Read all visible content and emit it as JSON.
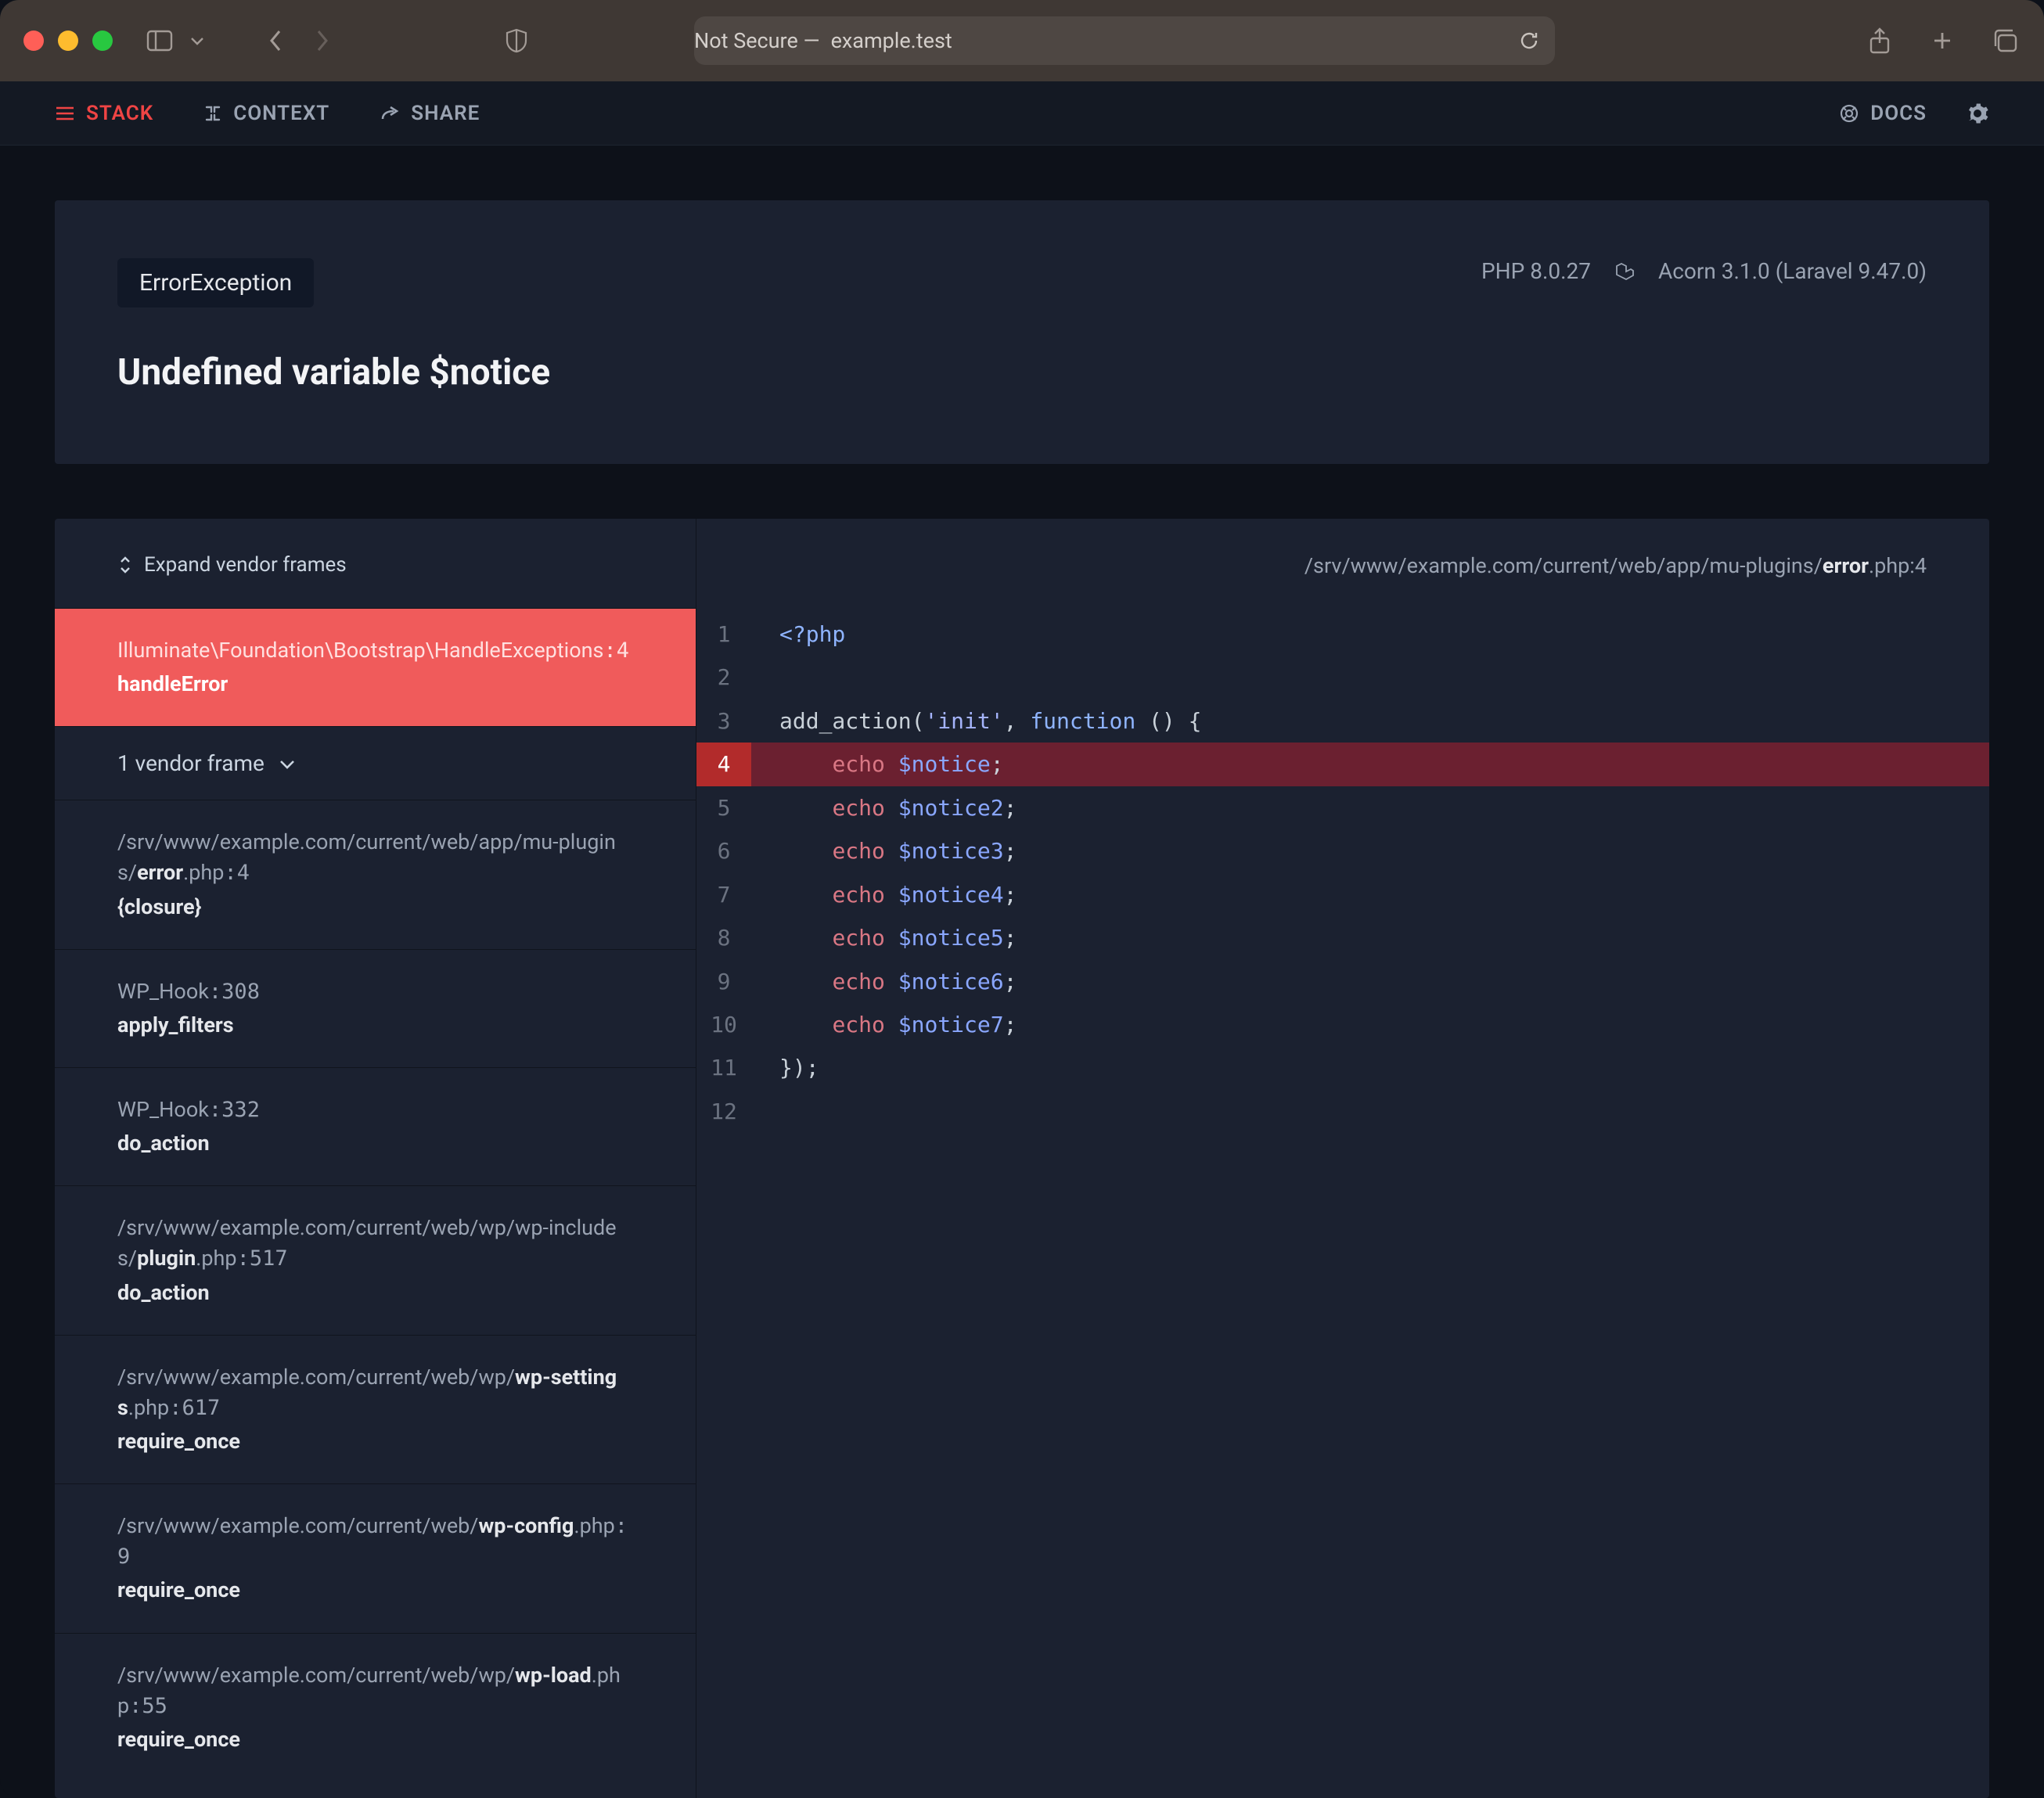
{
  "browser": {
    "address_prefix": "Not Secure —",
    "address_host": "example.test"
  },
  "nav": {
    "stack": "STACK",
    "context": "CONTEXT",
    "share": "SHARE",
    "docs": "DOCS"
  },
  "header": {
    "exception_class": "ErrorException",
    "php_version": "PHP 8.0.27",
    "framework": "Acorn 3.1.0 (Laravel 9.47.0)",
    "message": "Undefined variable $notice"
  },
  "stack": {
    "expand_label": "Expand vendor frames",
    "vendor_collapsed_label": "1 vendor frame",
    "frames": [
      {
        "path": "Illuminate\\Foundation\\Bootstrap\\HandleExceptions",
        "line": "4",
        "method": "handleError",
        "active": true,
        "is_class": true
      },
      {
        "path_prefix": "/srv/www/example.com/current/web/app/mu-plugins/",
        "file": "error",
        "ext": ".php",
        "line": "4",
        "method": "{closure}"
      },
      {
        "path_prefix": "WP_Hook",
        "line": "308",
        "method": "apply_filters",
        "is_class": true
      },
      {
        "path_prefix": "WP_Hook",
        "line": "332",
        "method": "do_action",
        "is_class": true
      },
      {
        "path_prefix": "/srv/www/example.com/current/web/wp/wp-includes/",
        "file": "plugin",
        "ext": ".php",
        "line": "517",
        "method": "do_action"
      },
      {
        "path_prefix": "/srv/www/example.com/current/web/wp/",
        "file": "wp-settings",
        "ext": ".php",
        "line": "617",
        "method": "require_once"
      },
      {
        "path_prefix": "/srv/www/example.com/current/web/",
        "file": "wp-config",
        "ext": ".php",
        "line": "9",
        "method": "require_once"
      },
      {
        "path_prefix": "/srv/www/example.com/current/web/wp/",
        "file": "wp-load",
        "ext": ".php",
        "line": "55",
        "method": "require_once"
      }
    ]
  },
  "code": {
    "file_path_prefix": "/srv/www/example.com/current/web/app/mu-plugins/",
    "file_name": "error",
    "file_ext": ".php",
    "file_line": "4",
    "highlight_line": 4,
    "lines": [
      {
        "n": 1,
        "tokens": [
          [
            "tag",
            "<?php"
          ]
        ]
      },
      {
        "n": 2,
        "tokens": []
      },
      {
        "n": 3,
        "tokens": [
          [
            "fn",
            "add_action"
          ],
          [
            "pn",
            "("
          ],
          [
            "str",
            "'init'"
          ],
          [
            "pn",
            ", "
          ],
          [
            "kw",
            "function"
          ],
          [
            "pn",
            " () {"
          ]
        ]
      },
      {
        "n": 4,
        "tokens": [
          [
            "pn",
            "    "
          ],
          [
            "echo",
            "echo"
          ],
          [
            "pn",
            " "
          ],
          [
            "var",
            "$notice"
          ],
          [
            "pn",
            ";"
          ]
        ]
      },
      {
        "n": 5,
        "tokens": [
          [
            "pn",
            "    "
          ],
          [
            "echo",
            "echo"
          ],
          [
            "pn",
            " "
          ],
          [
            "var",
            "$notice2"
          ],
          [
            "pn",
            ";"
          ]
        ]
      },
      {
        "n": 6,
        "tokens": [
          [
            "pn",
            "    "
          ],
          [
            "echo",
            "echo"
          ],
          [
            "pn",
            " "
          ],
          [
            "var",
            "$notice3"
          ],
          [
            "pn",
            ";"
          ]
        ]
      },
      {
        "n": 7,
        "tokens": [
          [
            "pn",
            "    "
          ],
          [
            "echo",
            "echo"
          ],
          [
            "pn",
            " "
          ],
          [
            "var",
            "$notice4"
          ],
          [
            "pn",
            ";"
          ]
        ]
      },
      {
        "n": 8,
        "tokens": [
          [
            "pn",
            "    "
          ],
          [
            "echo",
            "echo"
          ],
          [
            "pn",
            " "
          ],
          [
            "var",
            "$notice5"
          ],
          [
            "pn",
            ";"
          ]
        ]
      },
      {
        "n": 9,
        "tokens": [
          [
            "pn",
            "    "
          ],
          [
            "echo",
            "echo"
          ],
          [
            "pn",
            " "
          ],
          [
            "var",
            "$notice6"
          ],
          [
            "pn",
            ";"
          ]
        ]
      },
      {
        "n": 10,
        "tokens": [
          [
            "pn",
            "    "
          ],
          [
            "echo",
            "echo"
          ],
          [
            "pn",
            " "
          ],
          [
            "var",
            "$notice7"
          ],
          [
            "pn",
            ";"
          ]
        ]
      },
      {
        "n": 11,
        "tokens": [
          [
            "pn",
            "});"
          ]
        ]
      },
      {
        "n": 12,
        "tokens": []
      }
    ]
  }
}
